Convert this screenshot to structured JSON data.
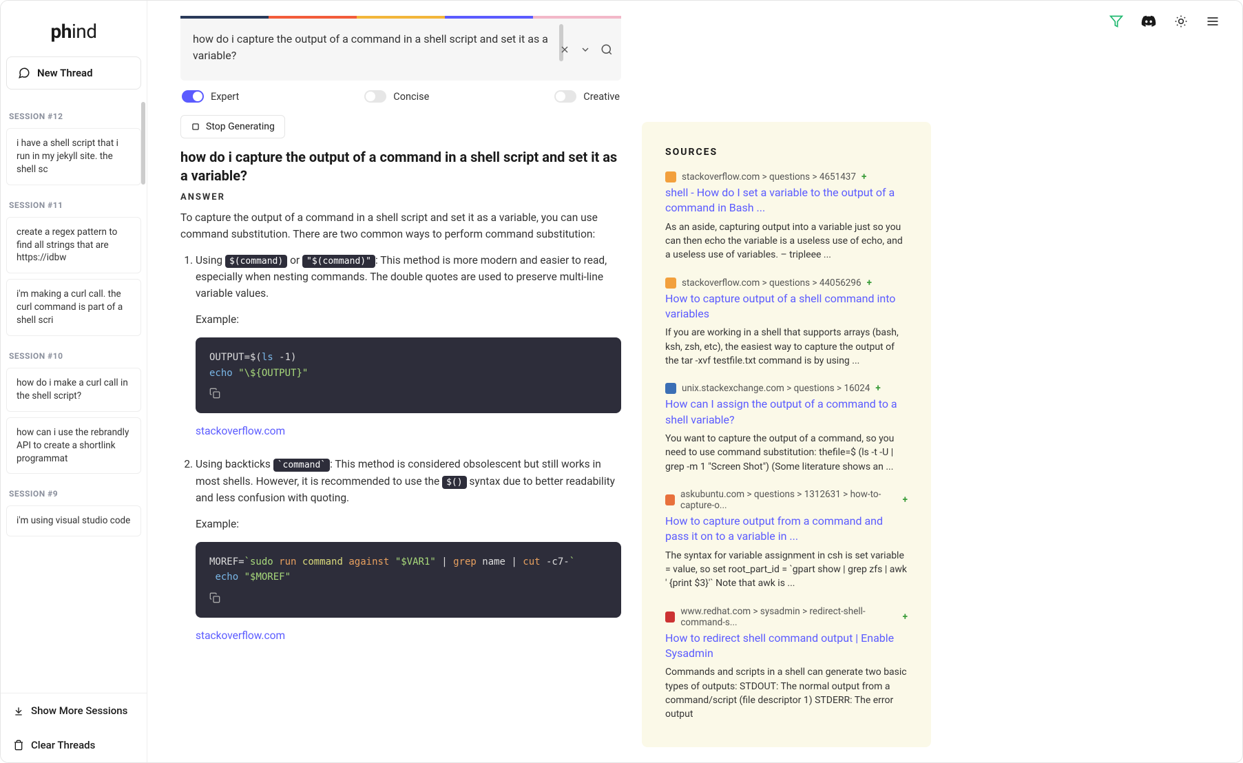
{
  "brand": {
    "name1": "ph",
    "name2": "ind"
  },
  "sidebar": {
    "new_thread": "New Thread",
    "show_more": "Show More Sessions",
    "clear_threads": "Clear Threads",
    "sessions": [
      {
        "header": "SESSION #12",
        "items": [
          "i have a shell script that i run in my jekyll site. the shell sc"
        ]
      },
      {
        "header": "SESSION #11",
        "items": [
          "create a regex pattern to find all strings that are https://idbw",
          "i'm making a curl call. the curl command is part of a shell scri"
        ]
      },
      {
        "header": "SESSION #10",
        "items": [
          "how do i make a curl call in the shell script?",
          "how can i use the rebrandly API to create a shortlink programmat"
        ]
      },
      {
        "header": "SESSION #9",
        "items": [
          "i'm using visual studio code"
        ]
      }
    ]
  },
  "search": {
    "query": "how do i capture the output of a command in a shell script and set it as a variable?"
  },
  "toggles": {
    "expert": "Expert",
    "concise": "Concise",
    "creative": "Creative"
  },
  "stop_label": "Stop Generating",
  "question": "how do i capture the output of a command in a shell script and set it as a variable?",
  "answer_label": "ANSWER",
  "answer": {
    "intro": "To capture the output of a command in a shell script and set it as a variable, you can use command substitution. There are two common ways to perform command substitution:",
    "m1_a": "Using ",
    "m1_code1": "$(command)",
    "m1_b": " or ",
    "m1_code2": "\"$(command)\"",
    "m1_c": ": This method is more modern and easier to read, especially when nesting commands. The double quotes are used to preserve multi-line variable values.",
    "example_label": "Example:",
    "src_link": "stackoverflow.com",
    "m2_a": "Using backticks ",
    "m2_code1": "`command`",
    "m2_b": ": This method is considered obsolescent but still works in most shells. However, it is recommended to use the ",
    "m2_code2": "$()",
    "m2_c": " syntax due to better readability and less confusion with quoting."
  },
  "sources_label": "SOURCES",
  "sources": [
    {
      "fav": "#f2a03d",
      "url": "stackoverflow.com > questions > 4651437",
      "title": "shell - How do I set a variable to the output of a command in Bash ...",
      "desc": "As an aside, capturing output into a variable just so you can then echo the variable is a useless use of echo, and a useless use of variables. – tripleee ..."
    },
    {
      "fav": "#f2a03d",
      "url": "stackoverflow.com > questions > 44056296",
      "title": "How to capture output of a shell command into variables",
      "desc": "If you are working in a shell that supports arrays (bash, ksh, zsh, etc), the easiest way to capture the output of the tar -xvf testfile.txt command is by using ..."
    },
    {
      "fav": "#3b6fb5",
      "url": "unix.stackexchange.com > questions > 16024",
      "title": "How can I assign the output of a command to a shell variable?",
      "desc": "You want to capture the output of a command, so you need to use command substitution: thefile=$ (ls -t -U | grep -m 1 \"Screen Shot\") (Some literature shows an ..."
    },
    {
      "fav": "#e8713c",
      "url": "askubuntu.com > questions > 1312631 > how-to-capture-o...",
      "title": "How to capture output from a command and pass it on to a variable in ...",
      "desc": "The syntax for variable assignment in csh is set variable = value, so set root_part_id = `gpart show | grep zfs | awk ' {print $3}'` Note that awk is ..."
    },
    {
      "fav": "#c33",
      "url": "www.redhat.com > sysadmin > redirect-shell-command-s...",
      "title": "How to redirect shell command output | Enable Sysadmin",
      "desc": "Commands and scripts in a shell can generate two basic types of outputs: STDOUT: The normal output from a command/script (file descriptor 1) STDERR: The error output"
    }
  ],
  "rainbow": [
    "#2a3b5a",
    "#f25c3b",
    "#f2b63b",
    "#5b5bff",
    "#f2b8c8"
  ]
}
